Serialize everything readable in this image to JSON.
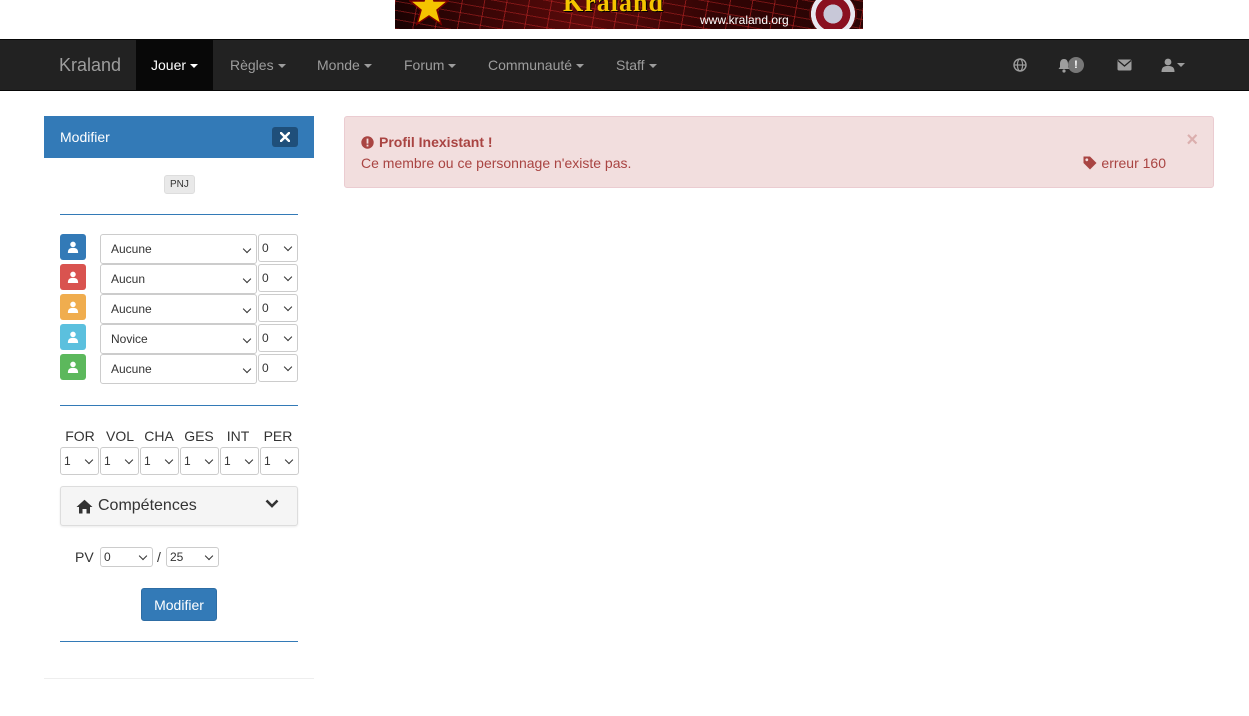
{
  "banner": {
    "brand": "Kraland",
    "url": "www.kraland.org"
  },
  "navbar": {
    "brand": "Kraland",
    "items": [
      {
        "label": "Jouer",
        "active": true
      },
      {
        "label": "Règles"
      },
      {
        "label": "Monde"
      },
      {
        "label": "Forum"
      },
      {
        "label": "Communauté"
      },
      {
        "label": "Staff"
      }
    ],
    "notification_badge": "!"
  },
  "sidebar": {
    "title": "Modifier",
    "tag": "PNJ",
    "attributes": [
      {
        "color": "#337ab7",
        "value": "Aucune",
        "level": "0"
      },
      {
        "color": "#d9534f",
        "value": "Aucun",
        "level": "0"
      },
      {
        "color": "#f0ad4e",
        "value": "Aucune",
        "level": "0"
      },
      {
        "color": "#5bc0de",
        "value": "Novice",
        "level": "0"
      },
      {
        "color": "#5cb85c",
        "value": "Aucune",
        "level": "0"
      }
    ],
    "stats": {
      "headers": [
        "FOR",
        "VOL",
        "CHA",
        "GES",
        "INT",
        "PER"
      ],
      "values": [
        "1",
        "1",
        "1",
        "1",
        "1",
        "1"
      ]
    },
    "competences_label": "Compétences",
    "pv": {
      "label": "PV",
      "current": "0",
      "max": "25",
      "separator": "/"
    },
    "submit_label": "Modifier"
  },
  "alert": {
    "title": "Profil Inexistant !",
    "message": "Ce membre ou ce personnage n'existe pas.",
    "error_tag": "erreur 160",
    "close": "×"
  }
}
